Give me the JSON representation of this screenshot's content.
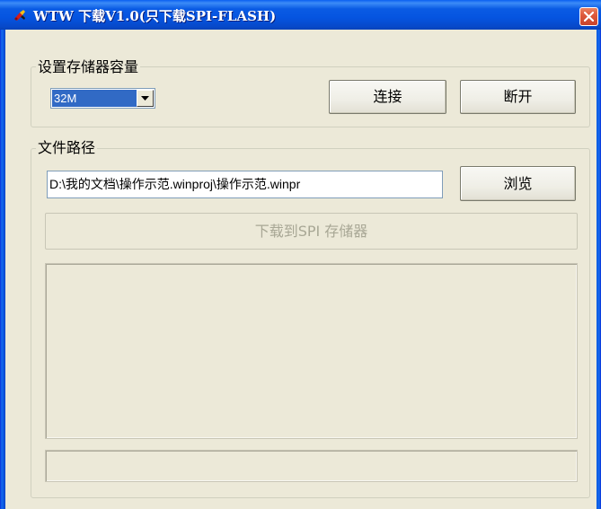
{
  "window": {
    "title": "WTW 下载V1.0(只下载SPI-FLASH)"
  },
  "icons": {
    "app": "pepper-app-icon",
    "close": "close-icon",
    "dropdown": "chevron-down-icon"
  },
  "colors": {
    "titlebar": "#0554e0",
    "close_button": "#de5a3c",
    "window_bg": "#ece9d8",
    "selection": "#316ac5"
  },
  "storage_group": {
    "caption": "设置存储器容量",
    "capacity_value": "32M",
    "connect_label": "连接",
    "disconnect_label": "断开"
  },
  "path_group": {
    "caption": "文件路径",
    "path_value": "D:\\我的文档\\操作示范.winproj\\操作示范.winpr",
    "browse_label": "浏览",
    "download_label": "下载到SPI 存储器",
    "log_text": "",
    "status_text": ""
  }
}
